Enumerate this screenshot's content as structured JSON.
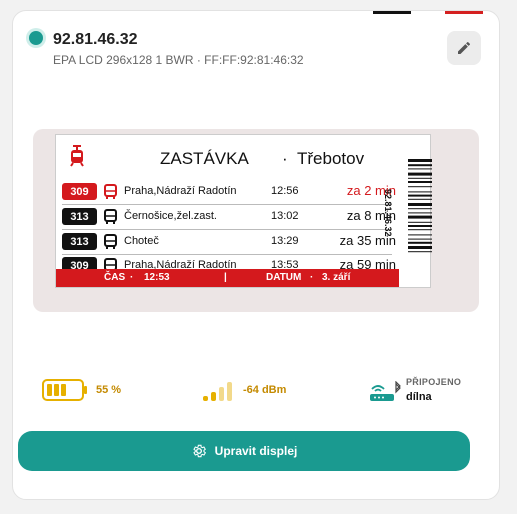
{
  "device": {
    "name": "92.81.46.32",
    "details": "EPA LCD 296x128 1 BWR · FF:FF:92:81:46:32"
  },
  "display": {
    "title": "ZASTÁVKA",
    "separator": "·",
    "stop_name": "Třebotov",
    "barcode_text": "92.81.46.32",
    "departures": [
      {
        "line": "309",
        "badge": "red",
        "vehicle": "bus-red-icon",
        "destination": "Praha,Nádraží Radotín",
        "time": "12:56",
        "eta": "za 2 min",
        "eta_color": "red"
      },
      {
        "line": "313",
        "badge": "black",
        "vehicle": "bus-icon",
        "destination": "Černošice,žel.zast.",
        "time": "13:02",
        "eta": "za 8 min",
        "eta_color": "black"
      },
      {
        "line": "313",
        "badge": "black",
        "vehicle": "bus-icon",
        "destination": "Choteč",
        "time": "13:29",
        "eta": "za 35 min",
        "eta_color": "black"
      },
      {
        "line": "309",
        "badge": "black",
        "vehicle": "bus-icon",
        "destination": "Praha,Nádraží Radotín",
        "time": "13:53",
        "eta": "za 59 min",
        "eta_color": "black"
      }
    ],
    "footer": {
      "time_label": "ČAS",
      "time_value": "12:53",
      "divider": "|",
      "date_label": "DATUM",
      "date_value": "3. září",
      "dot": "·"
    }
  },
  "stats": {
    "battery_percent": "55 %",
    "battery_level": 0.55,
    "signal": "-64 dBm",
    "connection_status": "PŘIPOJENO",
    "connection_name": "dílna"
  },
  "actions": {
    "edit_display": "Upravit displej"
  },
  "colors": {
    "accent": "#1a9a90",
    "warning": "#c48a00",
    "epaper_red": "#d4191d"
  }
}
